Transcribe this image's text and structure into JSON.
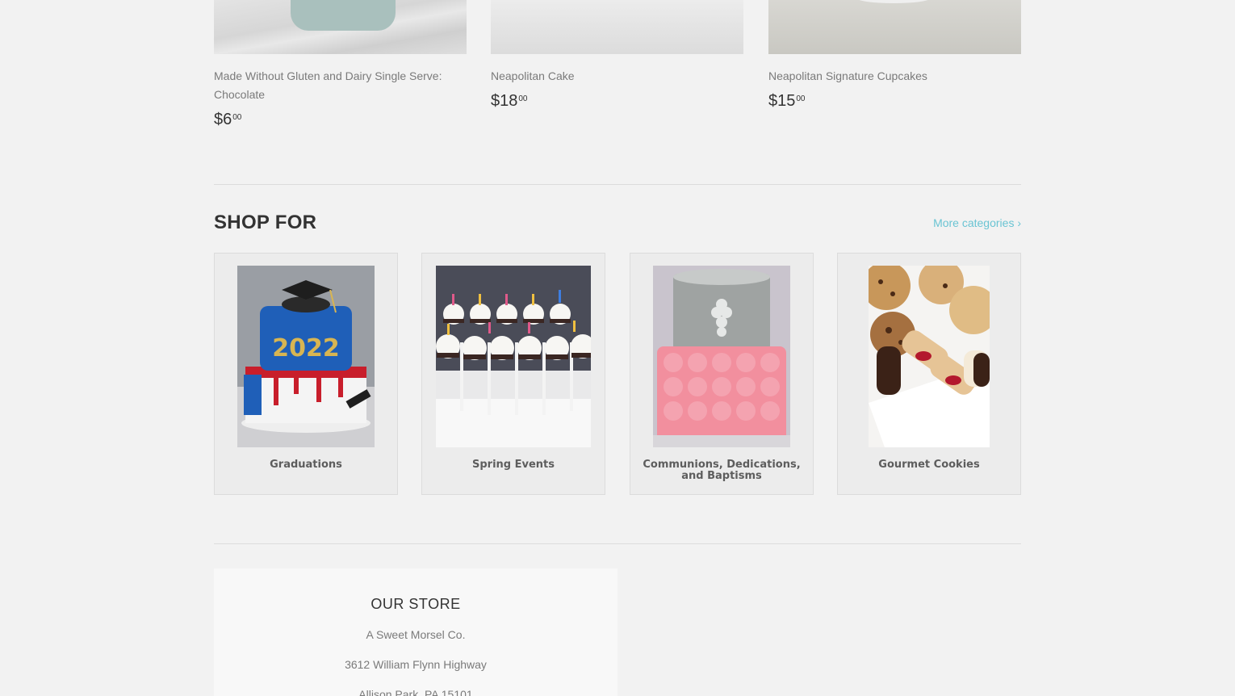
{
  "products": [
    {
      "title": "Made Without Gluten and Dairy Single Serve: Chocolate",
      "price_main": "$6",
      "price_cents": "00"
    },
    {
      "title": "Neapolitan Cake",
      "price_main": "$18",
      "price_cents": "00"
    },
    {
      "title": "Neapolitan Signature Cupcakes",
      "price_main": "$15",
      "price_cents": "00"
    }
  ],
  "shop_for": {
    "heading": "SHOP FOR",
    "more_link": "More categories ›",
    "categories": [
      {
        "label": "Graduations"
      },
      {
        "label": "Spring Events"
      },
      {
        "label": "Communions, Dedications, and Baptisms"
      },
      {
        "label": "Gourmet Cookies"
      }
    ]
  },
  "store": {
    "heading": "OUR STORE",
    "name": "A Sweet Morsel Co.",
    "address": "3612 William Flynn Highway",
    "city": "Allison Park, PA 15101"
  }
}
